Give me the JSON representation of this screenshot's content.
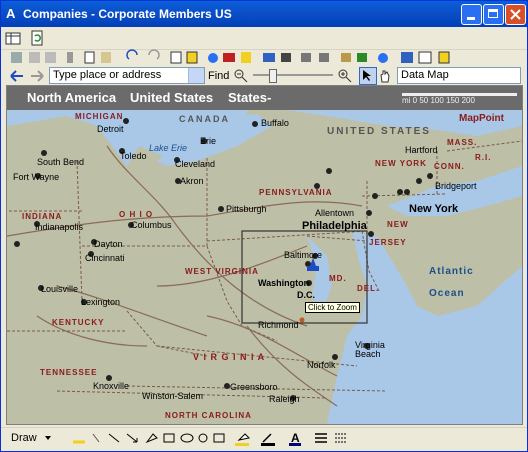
{
  "window": {
    "title": "Companies - Corporate Members US"
  },
  "toolbar2": {
    "place_placeholder": "Type place or address",
    "find_label": "Find",
    "data_map": "Data Map"
  },
  "map": {
    "header": {
      "region1": "North America",
      "region2": "United States",
      "region3": "States-"
    },
    "scale": {
      "text": "mi 0   50      100     150   200"
    },
    "logo": "MapPoint",
    "countries": {
      "canada": "CANADA",
      "us": "UNITED STATES"
    },
    "lake": "Lake Erie",
    "states": {
      "michigan": "MICHIGAN",
      "indiana": "INDIANA",
      "ohio": "O H I O",
      "kentucky": "KENTUCKY",
      "pennsylvania": "PENNSYLVANIA",
      "west_virginia": "WEST VIRGINIA",
      "virginia": "V I R G I N I A",
      "new_york": "NEW YORK",
      "conn": "CONN.",
      "mass": "MASS.",
      "ri": "R.I.",
      "new_jersey_a": "NEW",
      "new_jersey_b": "JERSEY",
      "md": "MD.",
      "del": "DEL.",
      "tennessee": "TENNESSEE",
      "north_carolina": "NORTH CAROLINA"
    },
    "cities": {
      "detroit": "Detroit",
      "toledo": "Toledo",
      "south_bend": "South Bend",
      "fort_wayne": "Fort Wayne",
      "indianapolis": "Indianapolis",
      "dayton": "Dayton",
      "cincinnati": "Cincinnati",
      "columbus": "Columbus",
      "louisville": "Louisville",
      "lexington": "Lexington",
      "cleveland": "Cleveland",
      "akron": "Akron",
      "erie": "Erie",
      "buffalo": "Buffalo",
      "pittsburgh": "Pittsburgh",
      "allentown": "Allentown",
      "hartford": "Hartford",
      "bridgeport": "Bridgeport",
      "new_york": "New York",
      "philadelphia": "Philadelphia",
      "baltimore": "Baltimore",
      "washington": "Washington",
      "dc": "D.C.",
      "richmond": "Richmond",
      "norfolk": "Norfolk",
      "virginia": "Virginia",
      "beach": "Beach",
      "knoxville": "Knoxville",
      "winston_salem": "Winston-Salem",
      "greensboro": "Greensboro",
      "raleigh": "Raleigh"
    },
    "ocean1": "Atlantic",
    "ocean2": "Ocean",
    "tooltip": "Click to Zoom"
  },
  "drawbar": {
    "draw_label": "Draw"
  }
}
